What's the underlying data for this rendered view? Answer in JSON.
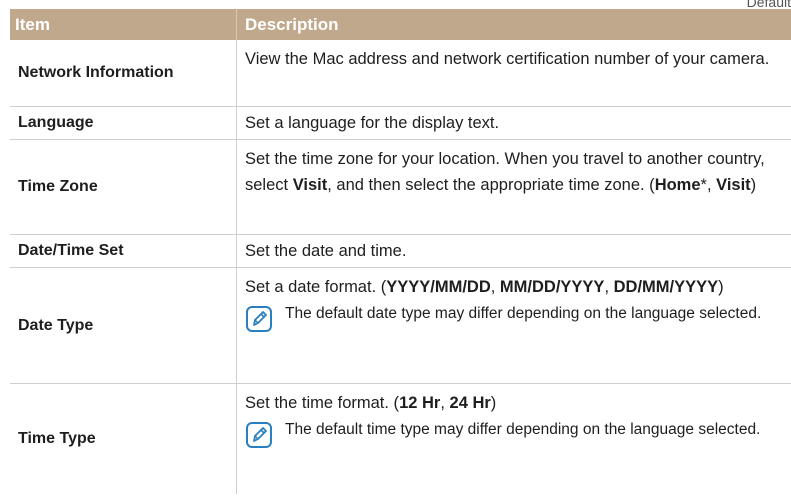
{
  "corner_note": "Default",
  "table": {
    "headers": {
      "item": "Item",
      "description": "Description"
    },
    "rows": {
      "network": {
        "item": "Network Information",
        "desc": "View the Mac address and network certification number of your camera."
      },
      "language": {
        "item": "Language",
        "desc": "Set a language for the display text."
      },
      "timezone": {
        "item": "Time Zone",
        "desc_a": "Set the time zone for your location. When you travel to another country, select ",
        "visit1": "Visit",
        "desc_b": ", and then select the appropriate time zone. (",
        "home": "Home",
        "star": "*",
        "comma": ", ",
        "visit2": "Visit",
        "close": ")"
      },
      "datetime": {
        "item": "Date/Time Set",
        "desc": "Set the date and time."
      },
      "datetype": {
        "item": "Date Type",
        "desc_a": "Set a date format. (",
        "opt1": "YYYY/MM/DD",
        "sep1": ", ",
        "opt2": "MM/DD/YYYY",
        "sep2": ", ",
        "opt3": "DD/MM/YYYY",
        "close": ")",
        "note": "The default date type may differ depending on the language selected."
      },
      "timetype": {
        "item": "Time Type",
        "desc_a": "Set the time format. (",
        "opt1": "12 Hr",
        "sep1": ", ",
        "opt2": "24 Hr",
        "close": ")",
        "note": "The default time type may differ depending on the language selected."
      }
    }
  },
  "icons": {
    "note": "note-pencil-icon"
  },
  "colors": {
    "header_bg": "#bfa88c",
    "note_icon": "#2a7fc0"
  }
}
